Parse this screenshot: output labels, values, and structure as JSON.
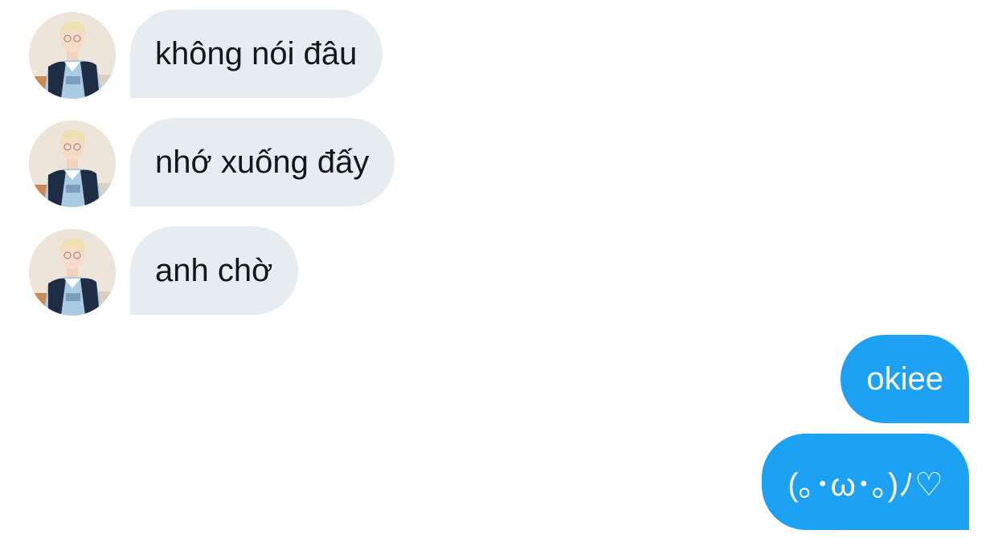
{
  "colors": {
    "incoming_bubble": "#e6ecf0",
    "incoming_text": "#14171a",
    "outgoing_bubble": "#1da1f2",
    "outgoing_text": "#ffffff"
  },
  "conversation": {
    "messages": [
      {
        "direction": "incoming",
        "text": "không nói đâu",
        "avatar": "sender-avatar"
      },
      {
        "direction": "incoming",
        "text": "nhớ xuống đấy",
        "avatar": "sender-avatar"
      },
      {
        "direction": "incoming",
        "text": "anh chờ",
        "avatar": "sender-avatar"
      },
      {
        "direction": "outgoing",
        "text": "okiee"
      },
      {
        "direction": "outgoing",
        "text": "(｡･ω･｡)ﾉ♡"
      }
    ]
  }
}
